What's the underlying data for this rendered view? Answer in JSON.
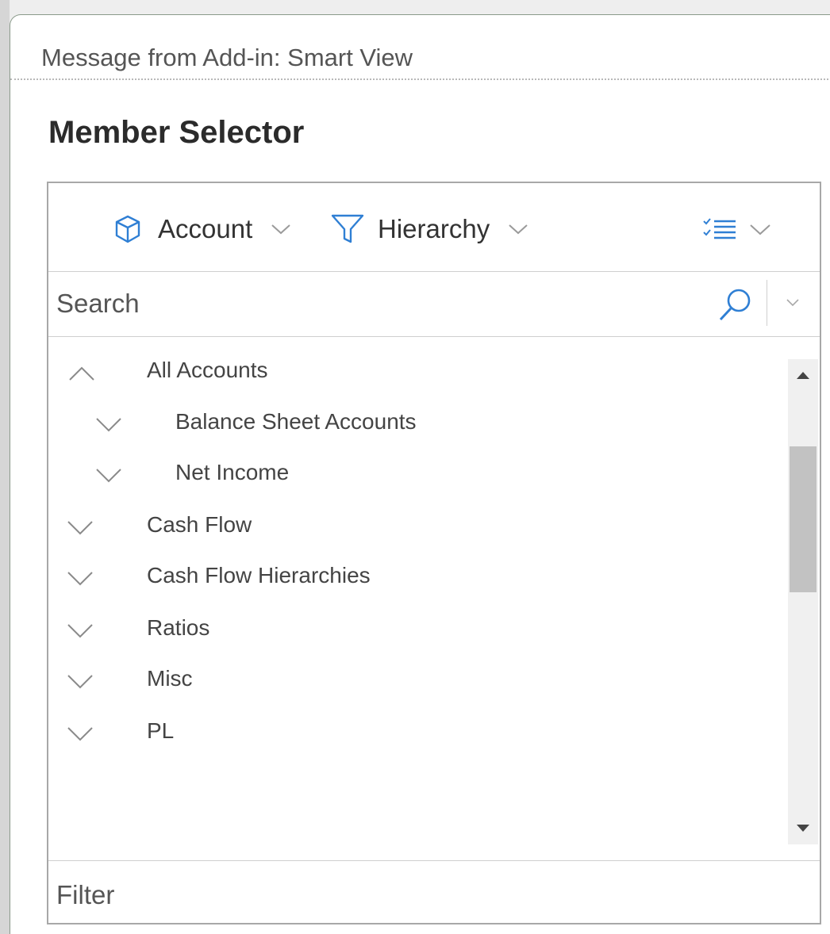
{
  "window": {
    "title": "Message from Add-in: Smart View"
  },
  "dialog": {
    "heading": "Member Selector"
  },
  "toolbar": {
    "dimension_label": "Account",
    "view_label": "Hierarchy",
    "dimension_icon": "cube-icon",
    "view_icon": "funnel-icon",
    "options_icon": "checklist-icon"
  },
  "search": {
    "placeholder": "Search",
    "value": ""
  },
  "tree": {
    "items": [
      {
        "label": "All Accounts",
        "expanded": true,
        "level": 0
      },
      {
        "label": "Balance Sheet Accounts",
        "expanded": false,
        "level": 1
      },
      {
        "label": "Net Income",
        "expanded": false,
        "level": 1
      },
      {
        "label": "Cash Flow",
        "expanded": false,
        "level": 0
      },
      {
        "label": "Cash Flow Hierarchies",
        "expanded": false,
        "level": 0
      },
      {
        "label": "Ratios",
        "expanded": false,
        "level": 0
      },
      {
        "label": "Misc",
        "expanded": false,
        "level": 0
      },
      {
        "label": "PL",
        "expanded": false,
        "level": 0
      }
    ]
  },
  "filter": {
    "label": "Filter"
  },
  "colors": {
    "accent": "#2f7fd4",
    "chevron": "#9a9a9a"
  }
}
